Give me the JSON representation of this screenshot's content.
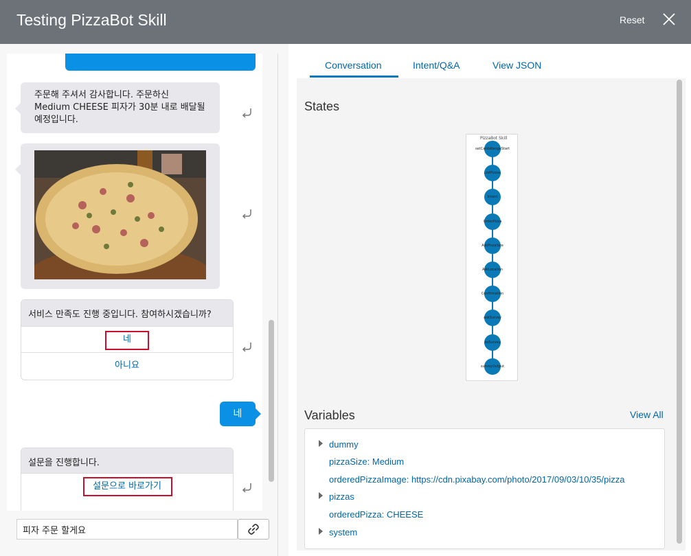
{
  "header": {
    "title": "Testing PizzaBot Skill",
    "reset_label": "Reset",
    "close_icon": "close-icon"
  },
  "chat": {
    "messages": {
      "order_confirm": "주문해 주셔서 감사합니다. 주문하신 Medium CHEESE 피자가 30분 내로 배달될 예정입니다.",
      "survey_prompt": "서비스 만족도 진행 중입니다. 참여하시겠습니까?",
      "survey_yes": "네",
      "survey_no": "아니요",
      "user_reply": "네",
      "survey_start": "설문을 진행합니다.",
      "survey_link": "설문으로 바로가기"
    },
    "input_value": "피자 주문 할게요",
    "attach_icon": "link-icon"
  },
  "tabs": [
    {
      "label": "Conversation",
      "active": true
    },
    {
      "label": "Intent/Q&A",
      "active": false
    },
    {
      "label": "View JSON",
      "active": false
    }
  ],
  "states": {
    "title": "States",
    "diagram_title": "PizzaBot Skill",
    "nodes": [
      "setCardsRangeStart",
      "ListPizzas",
      "Intent",
      "OrderPizza",
      "AskPizzaSize",
      "AskLocation",
      "Confirmation",
      "askSurvey",
      "doSurvey",
      "surveyOutput"
    ]
  },
  "variables": {
    "title": "Variables",
    "view_all": "View All",
    "items": [
      {
        "text": "dummy",
        "expandable": true
      },
      {
        "text": "pizzaSize: Medium",
        "expandable": false
      },
      {
        "text": "orderedPizzaImage: https://cdn.pixabay.com/photo/2017/09/03/10/35/pizza",
        "expandable": false
      },
      {
        "text": "pizzas",
        "expandable": true
      },
      {
        "text": "orderedPizza: CHEESE",
        "expandable": false
      },
      {
        "text": "system",
        "expandable": true
      }
    ]
  },
  "colors": {
    "header_bg": "#6d7278",
    "accent": "#0a90e4",
    "link": "#0066a8",
    "node": "#0b79b6",
    "highlight": "#c8102e"
  }
}
